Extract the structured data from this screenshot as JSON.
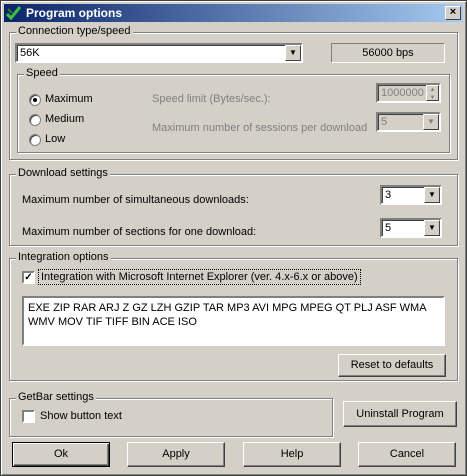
{
  "window": {
    "title": "Program options",
    "close_glyph": "×"
  },
  "connection": {
    "legend": "Connection type/speed",
    "type_value": "56K",
    "speed_display": "56000 bps"
  },
  "speed": {
    "legend": "Speed",
    "options": [
      "Maximum",
      "Medium",
      "Low"
    ],
    "selected": "Maximum",
    "speed_limit_label": "Speed limit (Bytes/sec.):",
    "speed_limit_value": "1000000",
    "max_sessions_label": "Maximum number of sessions per download",
    "max_sessions_value": "5"
  },
  "download": {
    "legend": "Download settings",
    "simultaneous_label": "Maximum number of simultaneous downloads:",
    "simultaneous_value": "3",
    "sections_label": "Maximum number of sections for one download:",
    "sections_value": "5"
  },
  "integration": {
    "legend": "Integration options",
    "ie_label": "Integration with Microsoft Internet Explorer (ver. 4.x-6.x or above)",
    "ie_checked": true,
    "extensions": "EXE ZIP RAR ARJ Z GZ LZH GZIP TAR MP3 AVI MPG MPEG QT PLJ ASF WMA WMV MOV TIF TIFF BIN ACE ISO",
    "reset_label": "Reset to defaults"
  },
  "getbar": {
    "legend": "GetBar settings",
    "show_text_label": "Show button text",
    "show_text_checked": false
  },
  "buttons": {
    "uninstall": "Uninstall Program",
    "ok": "Ok",
    "apply": "Apply",
    "help": "Help",
    "cancel": "Cancel"
  },
  "icons": {
    "app": "app-check-icon",
    "dropdown": "chevron-down-icon",
    "spin": "spin-updown-icon"
  }
}
